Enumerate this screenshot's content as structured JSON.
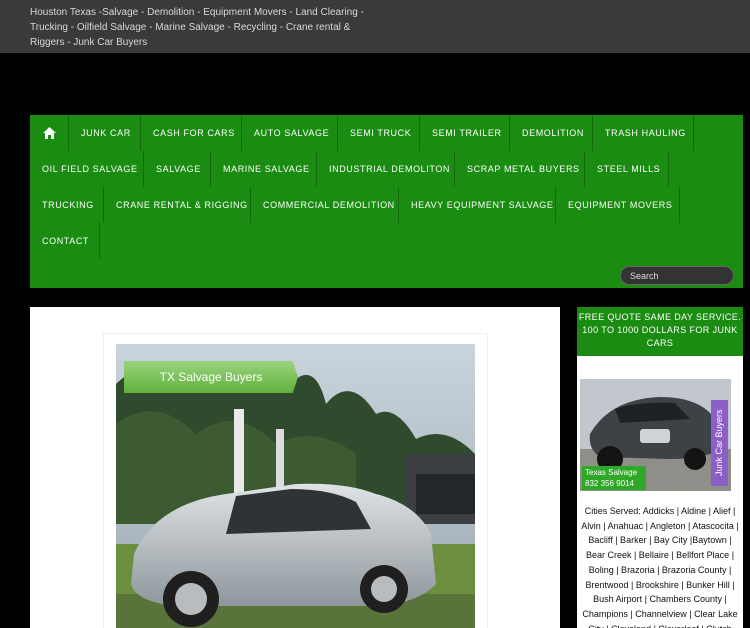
{
  "site": {
    "tagline": "Houston Texas -Salvage - Demolition - Equipment Movers - Land Clearing - Trucking - Oilfield Salvage - Marine Salvage - Recycling - Crane rental & Riggers - Junk Car Buyers"
  },
  "nav": {
    "home_icon": "home-icon",
    "items": [
      "JUNK CAR",
      "CASH FOR CARS",
      "AUTO SALVAGE",
      "SEMI TRUCK",
      "SEMI TRAILER",
      "DEMOLITION",
      "TRASH HAULING",
      "OIL FIELD SALVAGE",
      "SALVAGE",
      "MARINE SALVAGE",
      "INDUSTRIAL DEMOLITON",
      "SCRAP METAL BUYERS",
      "STEEL MILLS",
      "TRUCKING",
      "CRANE RENTAL & RIGGING",
      "COMMERCIAL DEMOLITION",
      "HEAVY EQUIPMENT SALVAGE",
      "EQUIPMENT MOVERS",
      "CONTACT"
    ],
    "accent_color": "#1a8c11"
  },
  "search": {
    "placeholder": "Search"
  },
  "main": {
    "photo_banner": "TX Salvage Buyers"
  },
  "sidebar": {
    "heading": "FREE QUOTE SAME DAY SERVICE. 100 TO 1000 DOLLARS FOR JUNK CARS",
    "ad_label_line1": "Texas Salvage",
    "ad_label_line2": "832 356 9014",
    "ad_vertical": "Junk Car Buyers",
    "cities": "Cities Served: Addicks | Aldine | Alief | Alvin | Anahuac | Angleton | Atascocita | Bacliff | Barker | Bay City |Baytown | Bear Creek | Bellaire | Bellfort Place | Boling | Brazoria | Brazoria County | Brentwood | Brookshire | Bunker Hill | Bush Airport | Chambers County | Champions | Channelview | Clear Lake City | Cleveland | Cloverleaf | Clutch City"
  }
}
